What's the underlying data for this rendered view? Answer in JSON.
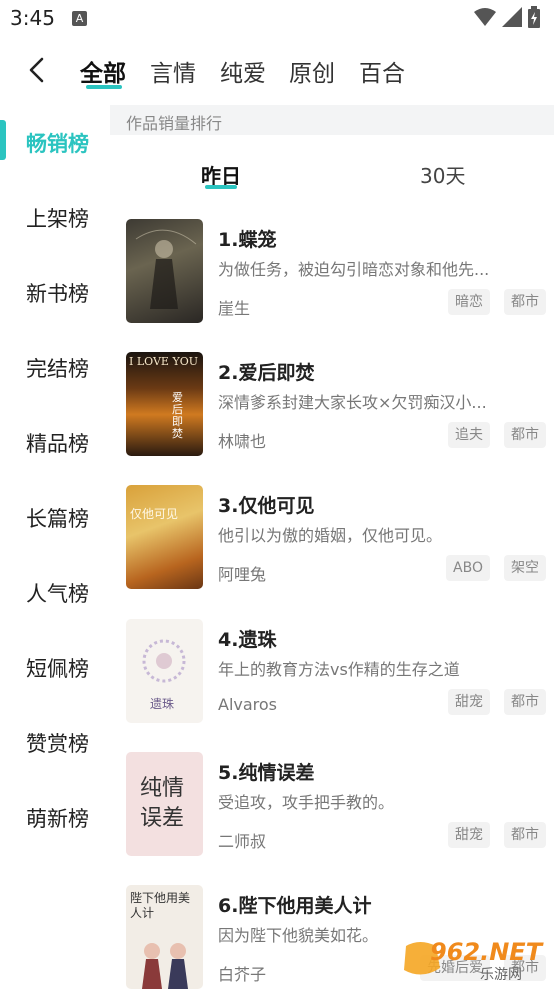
{
  "status_bar": {
    "time": "3:45",
    "notif": "A"
  },
  "top_nav": {
    "tabs": [
      "全部",
      "言情",
      "纯爱",
      "原创",
      "百合"
    ],
    "accent": "#2bc4c0"
  },
  "sidebar": {
    "items": [
      "畅销榜",
      "上架榜",
      "新书榜",
      "完结榜",
      "精品榜",
      "长篇榜",
      "人气榜",
      "短佩榜",
      "赞赏榜",
      "萌新榜"
    ]
  },
  "content": {
    "header": "作品销量排行",
    "sub_tabs": [
      "昨日",
      "30天"
    ],
    "books": [
      {
        "title": "1.蝶笼",
        "desc": "为做任务，被迫勾引暗恋对象和他先...",
        "author": "崖生",
        "tags": [
          "暗恋",
          "都市"
        ]
      },
      {
        "title": "2.爱后即焚",
        "desc": "深情爹系封建大家长攻×欠罚痴汉小...",
        "author": "林啸也",
        "tags": [
          "追夫",
          "都市"
        ]
      },
      {
        "title": "3.仅他可见",
        "desc": "他引以为傲的婚姻，仅他可见。",
        "author": "阿哩兔",
        "tags": [
          "ABO",
          "架空"
        ]
      },
      {
        "title": "4.遗珠",
        "desc": "年上的教育方法vs作精的生存之道",
        "author": "Alvaros",
        "tags": [
          "甜宠",
          "都市"
        ]
      },
      {
        "title": "5.纯情误差",
        "desc": "受追攻，攻手把手教的。",
        "author": "二师叔",
        "tags": [
          "甜宠",
          "都市"
        ]
      },
      {
        "title": "6.陛下他用美人计",
        "desc": "因为陛下他貌美如花。",
        "author": "白芥子",
        "tags": [
          "先婚后爱",
          "都市"
        ]
      }
    ],
    "covers": [
      {
        "text": "",
        "sub": ""
      },
      {
        "text": "I LOVE YOU",
        "sub": "爱后即焚"
      },
      {
        "text": "仅他可见",
        "sub": ""
      },
      {
        "text": "遗珠",
        "sub": ""
      },
      {
        "text": "纯情误差",
        "sub": ""
      },
      {
        "text": "陛下他用美人计",
        "sub": ""
      }
    ]
  },
  "watermark": {
    "brand": "962.NET",
    "sub": "乐游网"
  }
}
